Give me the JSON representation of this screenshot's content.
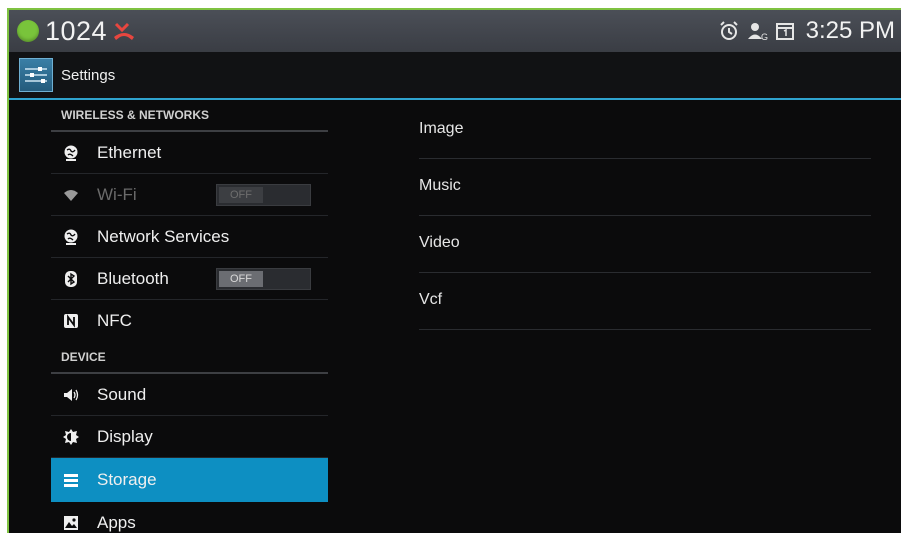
{
  "statusbar": {
    "number": "1024",
    "time": "3:25 PM",
    "icons": [
      "green-dot-icon",
      "missed-call-icon",
      "alarm-icon",
      "account-icon",
      "calendar-icon"
    ]
  },
  "actionbar": {
    "title": "Settings",
    "icon": "settings-sliders-icon"
  },
  "sidebar": {
    "sections": [
      {
        "header": "WIRELESS & NETWORKS"
      },
      {
        "header": "DEVICE"
      }
    ],
    "items": [
      {
        "label": "Ethernet",
        "icon": "globe-icon"
      },
      {
        "label": "Wi-Fi",
        "icon": "wifi-icon",
        "toggle": "OFF",
        "disabled": true
      },
      {
        "label": "Network Services",
        "icon": "globe-icon"
      },
      {
        "label": "Bluetooth",
        "icon": "bluetooth-icon",
        "toggle": "OFF"
      },
      {
        "label": "NFC",
        "icon": "nfc-icon"
      },
      {
        "label": "Sound",
        "icon": "speaker-icon"
      },
      {
        "label": "Display",
        "icon": "brightness-icon"
      },
      {
        "label": "Storage",
        "icon": "storage-icon",
        "selected": true
      },
      {
        "label": "Apps",
        "icon": "apps-icon"
      }
    ]
  },
  "content": {
    "items": [
      {
        "label": "Image"
      },
      {
        "label": "Music"
      },
      {
        "label": "Video"
      },
      {
        "label": "Vcf"
      }
    ]
  },
  "colors": {
    "accent": "#0d8fc2",
    "divider_accent": "#2fa3cf",
    "status_dot": "#79c43b",
    "frame": "#7fc241"
  }
}
